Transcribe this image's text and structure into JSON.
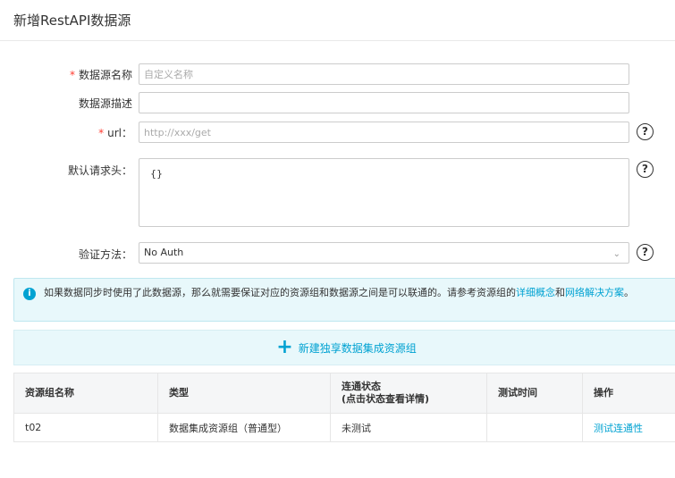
{
  "page": {
    "title": "新增RestAPI数据源"
  },
  "form": {
    "name": {
      "required_mark": "*",
      "label": "数据源名称",
      "placeholder": "自定义名称"
    },
    "description": {
      "label": "数据源描述"
    },
    "url": {
      "required_mark": "*",
      "label": "url：",
      "placeholder": "http://xxx/get"
    },
    "headers": {
      "label": "默认请求头：",
      "value": "{}"
    },
    "auth": {
      "label": "验证方法：",
      "value": "No Auth"
    },
    "help_glyph": "?"
  },
  "alert": {
    "icon": "i",
    "text_before": "如果数据同步时使用了此数据源，那么就需要保证对应的资源组和数据源之间是可以联通的。请参考资源组的",
    "link1": "详细概念",
    "text_mid": "和",
    "link2": "网络解决方案",
    "text_after": "。"
  },
  "add_button": {
    "icon": "+",
    "label": "新建独享数据集成资源组"
  },
  "table": {
    "headers": {
      "name": "资源组名称",
      "type": "类型",
      "status_line1": "连通状态",
      "status_line2": "(点击状态查看详情)",
      "test_time": "测试时间",
      "action": "操作"
    },
    "rows": [
      {
        "name": "t02",
        "type": "数据集成资源组（普通型）",
        "status": "未测试",
        "test_time": "",
        "action": "测试连通性"
      }
    ]
  },
  "icons": {
    "help": "question-circle-icon",
    "info": "info-circle-icon",
    "chevron": "chevron-down-icon",
    "add": "plus-icon"
  },
  "colors": {
    "accent": "#00a2d2",
    "required": "#ff3b30",
    "alert_bg": "#e8f8fb"
  }
}
